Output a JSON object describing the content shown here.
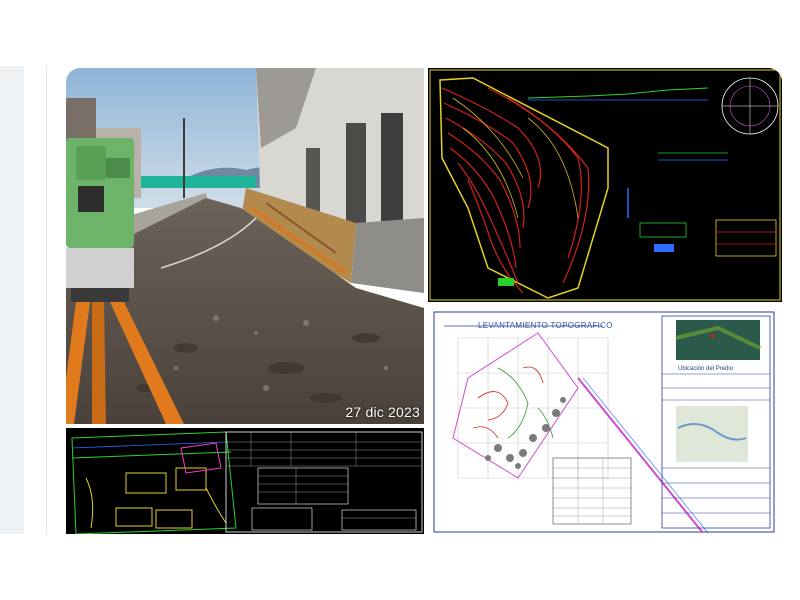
{
  "photo": {
    "date_stamp": "27 dic 2023"
  },
  "cad_plan": {
    "title": "LEVANTAMIENTO TOPOGRAFICO",
    "location_label": "Ubicación del Predio"
  },
  "colors": {
    "cad_background": "#000000",
    "contour_red": "#d2221c",
    "contour_yellow": "#e6d21e",
    "instrument_green": "#6db36a",
    "tripod_orange": "#e07a1c"
  }
}
